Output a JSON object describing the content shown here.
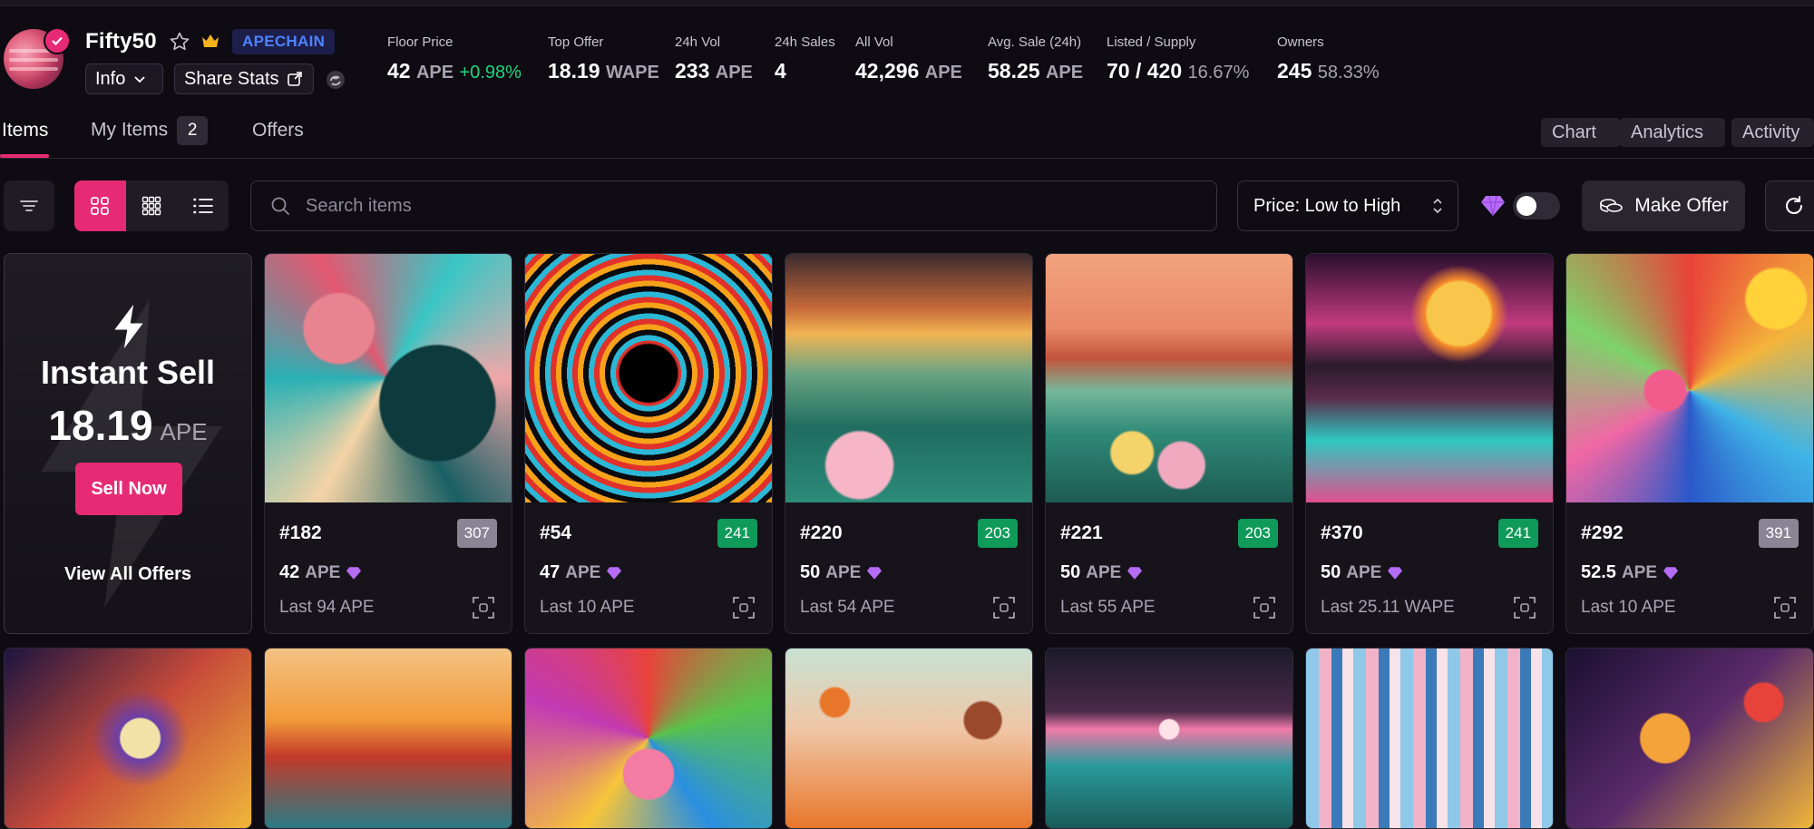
{
  "collection": {
    "name": "Fifty50",
    "chain": "APECHAIN",
    "info_label": "Info",
    "share_label": "Share Stats"
  },
  "stats": [
    {
      "label": "Floor Price",
      "value": "42",
      "unit": "APE",
      "extra": "+0.98%"
    },
    {
      "label": "Top Offer",
      "value": "18.19",
      "unit": "WAPE"
    },
    {
      "label": "24h Vol",
      "value": "233",
      "unit": "APE"
    },
    {
      "label": "24h Sales",
      "value": "4"
    },
    {
      "label": "All Vol",
      "value": "42,296",
      "unit": "APE"
    },
    {
      "label": "Avg. Sale (24h)",
      "value": "58.25",
      "unit": "APE"
    },
    {
      "label": "Listed / Supply",
      "value": "70 / 420",
      "extra": "16.67%"
    },
    {
      "label": "Owners",
      "value": "245",
      "extra": "58.33%"
    }
  ],
  "tabs": {
    "items": "Items",
    "my_items": "My Items",
    "my_items_count": "2",
    "offers": "Offers"
  },
  "right_tabs": {
    "chart": "Chart",
    "analytics": "Analytics",
    "activity": "Activity"
  },
  "toolbar": {
    "search_placeholder": "Search items",
    "sort_label": "Price: Low to High",
    "make_offer": "Make Offer"
  },
  "instant_sell": {
    "title": "Instant Sell",
    "price": "18.19",
    "unit": "APE",
    "sell_button": "Sell Now",
    "view_offers": "View All Offers"
  },
  "colors": {
    "accent": "#e72a74",
    "rank_green": "#0f9a5a",
    "rank_gray": "#8a8595",
    "chain_blue": "#4f82ff"
  },
  "items": [
    {
      "id": "#182",
      "rank": "307",
      "rank_style": "gray",
      "price": "42",
      "unit": "APE",
      "last": "Last 94 APE"
    },
    {
      "id": "#54",
      "rank": "241",
      "rank_style": "green",
      "price": "47",
      "unit": "APE",
      "last": "Last 10 APE"
    },
    {
      "id": "#220",
      "rank": "203",
      "rank_style": "green",
      "price": "50",
      "unit": "APE",
      "last": "Last 54 APE"
    },
    {
      "id": "#221",
      "rank": "203",
      "rank_style": "green",
      "price": "50",
      "unit": "APE",
      "last": "Last 55 APE"
    },
    {
      "id": "#370",
      "rank": "241",
      "rank_style": "green",
      "price": "50",
      "unit": "APE",
      "last": "Last 25.11 WAPE"
    },
    {
      "id": "#292",
      "rank": "391",
      "rank_style": "gray",
      "price": "52.5",
      "unit": "APE",
      "last": "Last 10 APE"
    }
  ]
}
